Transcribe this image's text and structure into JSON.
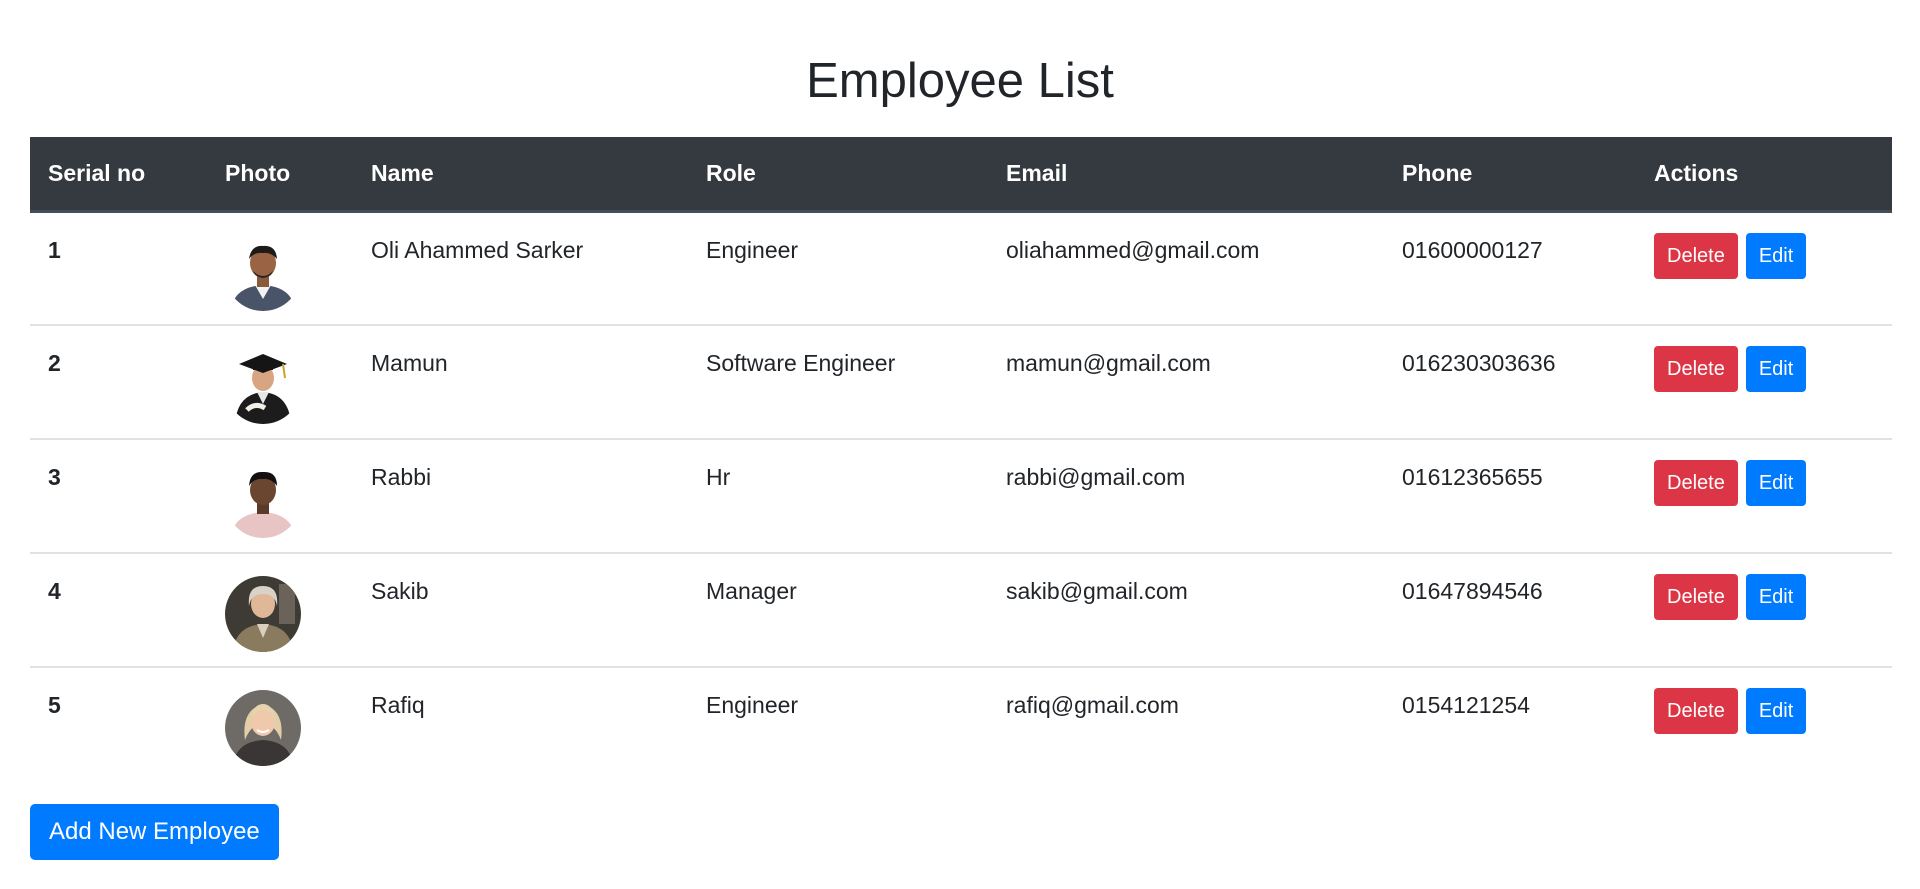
{
  "page": {
    "title": "Employee List"
  },
  "table": {
    "headers": {
      "serial": "Serial no",
      "photo": "Photo",
      "name": "Name",
      "role": "Role",
      "email": "Email",
      "phone": "Phone",
      "actions": "Actions"
    },
    "rows": [
      {
        "serial": "1",
        "photo_icon": "person-avatar-icon",
        "name": "Oli Ahammed Sarker",
        "role": "Engineer",
        "email": "oliahammed@gmail.com",
        "phone": "01600000127",
        "delete_label": "Delete",
        "edit_label": "Edit"
      },
      {
        "serial": "2",
        "photo_icon": "graduate-avatar-icon",
        "name": "Mamun",
        "role": "Software Engineer",
        "email": "mamun@gmail.com",
        "phone": "016230303636",
        "delete_label": "Delete",
        "edit_label": "Edit"
      },
      {
        "serial": "3",
        "photo_icon": "person-avatar-icon",
        "name": "Rabbi",
        "role": "Hr",
        "email": "rabbi@gmail.com",
        "phone": "01612365655",
        "delete_label": "Delete",
        "edit_label": "Edit"
      },
      {
        "serial": "4",
        "photo_icon": "person-avatar-icon",
        "name": "Sakib",
        "role": "Manager",
        "email": "sakib@gmail.com",
        "phone": "01647894546",
        "delete_label": "Delete",
        "edit_label": "Edit"
      },
      {
        "serial": "5",
        "photo_icon": "person-avatar-icon",
        "name": "Rafiq",
        "role": "Engineer",
        "email": "rafiq@gmail.com",
        "phone": "0154121254",
        "delete_label": "Delete",
        "edit_label": "Edit"
      }
    ]
  },
  "actions": {
    "add_label": "Add New Employee"
  },
  "colors": {
    "header_bg": "#343a40",
    "delete": "#dc3545",
    "primary": "#007bff",
    "text": "#212529",
    "divider": "#dee2e6"
  }
}
